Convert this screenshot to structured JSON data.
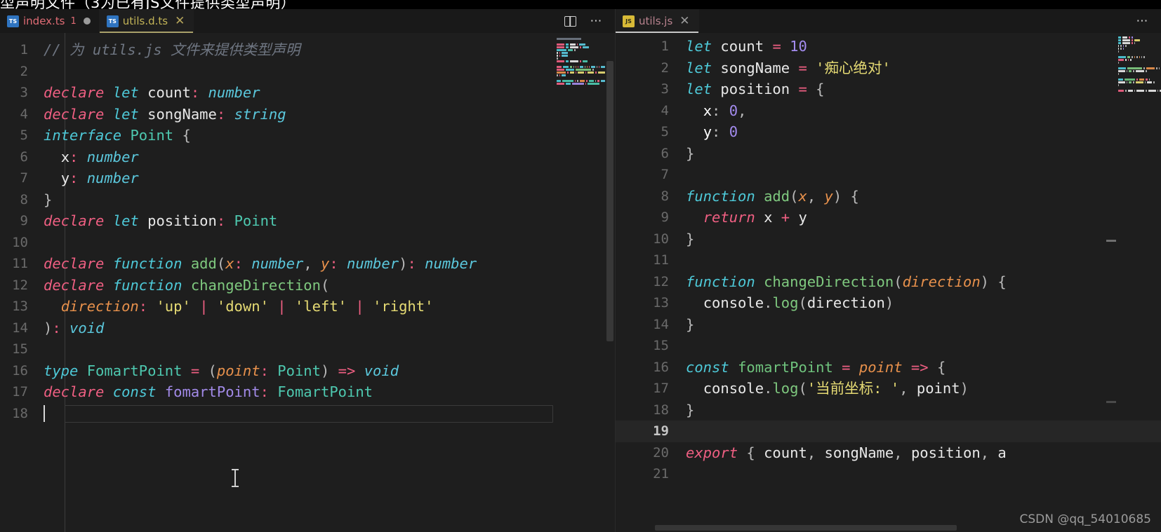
{
  "window": {
    "top_caption": "型声明文件（3为已有JS文件提供类型声明）",
    "watermark": "CSDN @qq_54010685"
  },
  "left_pane": {
    "tabs": [
      {
        "label": "index.ts",
        "icon": "ts-file-icon",
        "error_count": "1",
        "dirty": true,
        "active": false,
        "close": ""
      },
      {
        "label": "utils.d.ts",
        "icon": "ts-file-icon",
        "error_count": "",
        "dirty": false,
        "active": true,
        "close": "✕"
      }
    ],
    "actions": {
      "split": "split-editor-icon",
      "more": "⋯"
    },
    "file_language": "typescript",
    "cursor_line": 18,
    "lines": [
      {
        "n": 1,
        "tokens": [
          {
            "t": "// 为 utils.js 文件来提供类型声明",
            "c": "t-com"
          }
        ]
      },
      {
        "n": 2,
        "tokens": []
      },
      {
        "n": 3,
        "tokens": [
          {
            "t": "declare",
            "c": "t-kw"
          },
          {
            "t": " ",
            "c": "t-ws"
          },
          {
            "t": "let",
            "c": "t-kw2"
          },
          {
            "t": " ",
            "c": "t-ws"
          },
          {
            "t": "count",
            "c": "t-var"
          },
          {
            "t": ":",
            "c": "t-op"
          },
          {
            "t": " ",
            "c": "t-ws"
          },
          {
            "t": "number",
            "c": "t-type"
          }
        ]
      },
      {
        "n": 4,
        "tokens": [
          {
            "t": "declare",
            "c": "t-kw"
          },
          {
            "t": " ",
            "c": "t-ws"
          },
          {
            "t": "let",
            "c": "t-kw2"
          },
          {
            "t": " ",
            "c": "t-ws"
          },
          {
            "t": "songName",
            "c": "t-var"
          },
          {
            "t": ":",
            "c": "t-op"
          },
          {
            "t": " ",
            "c": "t-ws"
          },
          {
            "t": "string",
            "c": "t-type"
          }
        ]
      },
      {
        "n": 5,
        "tokens": [
          {
            "t": "interface",
            "c": "t-kw2"
          },
          {
            "t": " ",
            "c": "t-ws"
          },
          {
            "t": "Point",
            "c": "t-typ2"
          },
          {
            "t": " ",
            "c": "t-ws"
          },
          {
            "t": "{",
            "c": "t-punc"
          }
        ]
      },
      {
        "n": 6,
        "tokens": [
          {
            "t": "  ",
            "c": "t-ws"
          },
          {
            "t": "x",
            "c": "t-var"
          },
          {
            "t": ":",
            "c": "t-op"
          },
          {
            "t": " ",
            "c": "t-ws"
          },
          {
            "t": "number",
            "c": "t-type"
          }
        ]
      },
      {
        "n": 7,
        "tokens": [
          {
            "t": "  ",
            "c": "t-ws"
          },
          {
            "t": "y",
            "c": "t-var"
          },
          {
            "t": ":",
            "c": "t-op"
          },
          {
            "t": " ",
            "c": "t-ws"
          },
          {
            "t": "number",
            "c": "t-type"
          }
        ]
      },
      {
        "n": 8,
        "tokens": [
          {
            "t": "}",
            "c": "t-punc"
          }
        ]
      },
      {
        "n": 9,
        "tokens": [
          {
            "t": "declare",
            "c": "t-kw"
          },
          {
            "t": " ",
            "c": "t-ws"
          },
          {
            "t": "let",
            "c": "t-kw2"
          },
          {
            "t": " ",
            "c": "t-ws"
          },
          {
            "t": "position",
            "c": "t-var"
          },
          {
            "t": ":",
            "c": "t-op"
          },
          {
            "t": " ",
            "c": "t-ws"
          },
          {
            "t": "Point",
            "c": "t-typ2"
          }
        ]
      },
      {
        "n": 10,
        "tokens": []
      },
      {
        "n": 11,
        "tokens": [
          {
            "t": "declare",
            "c": "t-kw"
          },
          {
            "t": " ",
            "c": "t-ws"
          },
          {
            "t": "function",
            "c": "t-kw2"
          },
          {
            "t": " ",
            "c": "t-ws"
          },
          {
            "t": "add",
            "c": "t-fn"
          },
          {
            "t": "(",
            "c": "t-punc"
          },
          {
            "t": "x",
            "c": "t-param"
          },
          {
            "t": ":",
            "c": "t-op"
          },
          {
            "t": " ",
            "c": "t-ws"
          },
          {
            "t": "number",
            "c": "t-type"
          },
          {
            "t": ",",
            "c": "t-punc"
          },
          {
            "t": " ",
            "c": "t-ws"
          },
          {
            "t": "y",
            "c": "t-param"
          },
          {
            "t": ":",
            "c": "t-op"
          },
          {
            "t": " ",
            "c": "t-ws"
          },
          {
            "t": "number",
            "c": "t-type"
          },
          {
            "t": ")",
            "c": "t-punc"
          },
          {
            "t": ":",
            "c": "t-op"
          },
          {
            "t": " ",
            "c": "t-ws"
          },
          {
            "t": "number",
            "c": "t-type"
          }
        ]
      },
      {
        "n": 12,
        "tokens": [
          {
            "t": "declare",
            "c": "t-kw"
          },
          {
            "t": " ",
            "c": "t-ws"
          },
          {
            "t": "function",
            "c": "t-kw2"
          },
          {
            "t": " ",
            "c": "t-ws"
          },
          {
            "t": "changeDirection",
            "c": "t-fn"
          },
          {
            "t": "(",
            "c": "t-punc"
          }
        ]
      },
      {
        "n": 13,
        "tokens": [
          {
            "t": "  ",
            "c": "t-ws"
          },
          {
            "t": "direction",
            "c": "t-param"
          },
          {
            "t": ":",
            "c": "t-op"
          },
          {
            "t": " ",
            "c": "t-ws"
          },
          {
            "t": "'up'",
            "c": "t-str"
          },
          {
            "t": " ",
            "c": "t-ws"
          },
          {
            "t": "|",
            "c": "t-op"
          },
          {
            "t": " ",
            "c": "t-ws"
          },
          {
            "t": "'down'",
            "c": "t-str"
          },
          {
            "t": " ",
            "c": "t-ws"
          },
          {
            "t": "|",
            "c": "t-op"
          },
          {
            "t": " ",
            "c": "t-ws"
          },
          {
            "t": "'left'",
            "c": "t-str"
          },
          {
            "t": " ",
            "c": "t-ws"
          },
          {
            "t": "|",
            "c": "t-op"
          },
          {
            "t": " ",
            "c": "t-ws"
          },
          {
            "t": "'right'",
            "c": "t-str"
          }
        ]
      },
      {
        "n": 14,
        "tokens": [
          {
            "t": ")",
            "c": "t-punc"
          },
          {
            "t": ":",
            "c": "t-op"
          },
          {
            "t": " ",
            "c": "t-ws"
          },
          {
            "t": "void",
            "c": "t-type"
          }
        ]
      },
      {
        "n": 15,
        "tokens": []
      },
      {
        "n": 16,
        "tokens": [
          {
            "t": "type",
            "c": "t-kw2"
          },
          {
            "t": " ",
            "c": "t-ws"
          },
          {
            "t": "FomartPoint",
            "c": "t-typ2"
          },
          {
            "t": " ",
            "c": "t-ws"
          },
          {
            "t": "=",
            "c": "t-op"
          },
          {
            "t": " ",
            "c": "t-ws"
          },
          {
            "t": "(",
            "c": "t-punc"
          },
          {
            "t": "point",
            "c": "t-param"
          },
          {
            "t": ":",
            "c": "t-op"
          },
          {
            "t": " ",
            "c": "t-ws"
          },
          {
            "t": "Point",
            "c": "t-typ2"
          },
          {
            "t": ")",
            "c": "t-punc"
          },
          {
            "t": " ",
            "c": "t-ws"
          },
          {
            "t": "=>",
            "c": "t-op"
          },
          {
            "t": " ",
            "c": "t-ws"
          },
          {
            "t": "void",
            "c": "t-type"
          }
        ]
      },
      {
        "n": 17,
        "tokens": [
          {
            "t": "declare",
            "c": "t-kw"
          },
          {
            "t": " ",
            "c": "t-ws"
          },
          {
            "t": "const",
            "c": "t-kw2"
          },
          {
            "t": " ",
            "c": "t-ws"
          },
          {
            "t": "fomartPoint",
            "c": "t-ident"
          },
          {
            "t": ":",
            "c": "t-op"
          },
          {
            "t": " ",
            "c": "t-ws"
          },
          {
            "t": "FomartPoint",
            "c": "t-typ2"
          }
        ]
      },
      {
        "n": 18,
        "tokens": [],
        "caret": true,
        "selected_line": true
      }
    ]
  },
  "right_pane": {
    "tabs": [
      {
        "label": "utils.js",
        "icon": "js-file-icon",
        "error_count": "",
        "dirty": false,
        "active": true,
        "close": "✕"
      }
    ],
    "actions": {
      "more": "⋯"
    },
    "file_language": "javascript",
    "current_line": 19,
    "lines": [
      {
        "n": 1,
        "tokens": [
          {
            "t": "let",
            "c": "t-kw2"
          },
          {
            "t": " ",
            "c": "t-ws"
          },
          {
            "t": "count",
            "c": "t-var"
          },
          {
            "t": " ",
            "c": "t-ws"
          },
          {
            "t": "=",
            "c": "t-op"
          },
          {
            "t": " ",
            "c": "t-ws"
          },
          {
            "t": "10",
            "c": "t-num"
          }
        ]
      },
      {
        "n": 2,
        "tokens": [
          {
            "t": "let",
            "c": "t-kw2"
          },
          {
            "t": " ",
            "c": "t-ws"
          },
          {
            "t": "songName",
            "c": "t-var"
          },
          {
            "t": " ",
            "c": "t-ws"
          },
          {
            "t": "=",
            "c": "t-op"
          },
          {
            "t": " ",
            "c": "t-ws"
          },
          {
            "t": "'痴心绝对'",
            "c": "t-str"
          }
        ]
      },
      {
        "n": 3,
        "tokens": [
          {
            "t": "let",
            "c": "t-kw2"
          },
          {
            "t": " ",
            "c": "t-ws"
          },
          {
            "t": "position",
            "c": "t-var"
          },
          {
            "t": " ",
            "c": "t-ws"
          },
          {
            "t": "=",
            "c": "t-op"
          },
          {
            "t": " ",
            "c": "t-ws"
          },
          {
            "t": "{",
            "c": "t-punc"
          }
        ]
      },
      {
        "n": 4,
        "tokens": [
          {
            "t": "  ",
            "c": "t-ws"
          },
          {
            "t": "x",
            "c": "t-prop"
          },
          {
            "t": ":",
            "c": "t-punc"
          },
          {
            "t": " ",
            "c": "t-ws"
          },
          {
            "t": "0",
            "c": "t-num"
          },
          {
            "t": ",",
            "c": "t-punc"
          }
        ]
      },
      {
        "n": 5,
        "tokens": [
          {
            "t": "  ",
            "c": "t-ws"
          },
          {
            "t": "y",
            "c": "t-prop"
          },
          {
            "t": ":",
            "c": "t-punc"
          },
          {
            "t": " ",
            "c": "t-ws"
          },
          {
            "t": "0",
            "c": "t-num"
          }
        ]
      },
      {
        "n": 6,
        "tokens": [
          {
            "t": "}",
            "c": "t-punc"
          }
        ]
      },
      {
        "n": 7,
        "tokens": []
      },
      {
        "n": 8,
        "tokens": [
          {
            "t": "function",
            "c": "t-kw2"
          },
          {
            "t": " ",
            "c": "t-ws"
          },
          {
            "t": "add",
            "c": "t-fn"
          },
          {
            "t": "(",
            "c": "t-punc"
          },
          {
            "t": "x",
            "c": "t-param"
          },
          {
            "t": ",",
            "c": "t-punc"
          },
          {
            "t": " ",
            "c": "t-ws"
          },
          {
            "t": "y",
            "c": "t-param"
          },
          {
            "t": ")",
            "c": "t-punc"
          },
          {
            "t": " ",
            "c": "t-ws"
          },
          {
            "t": "{",
            "c": "t-punc"
          }
        ]
      },
      {
        "n": 9,
        "tokens": [
          {
            "t": "  ",
            "c": "t-ws"
          },
          {
            "t": "return",
            "c": "t-kw"
          },
          {
            "t": " ",
            "c": "t-ws"
          },
          {
            "t": "x",
            "c": "t-var"
          },
          {
            "t": " ",
            "c": "t-ws"
          },
          {
            "t": "+",
            "c": "t-op"
          },
          {
            "t": " ",
            "c": "t-ws"
          },
          {
            "t": "y",
            "c": "t-var"
          }
        ]
      },
      {
        "n": 10,
        "tokens": [
          {
            "t": "}",
            "c": "t-punc"
          }
        ]
      },
      {
        "n": 11,
        "tokens": []
      },
      {
        "n": 12,
        "tokens": [
          {
            "t": "function",
            "c": "t-kw2"
          },
          {
            "t": " ",
            "c": "t-ws"
          },
          {
            "t": "changeDirection",
            "c": "t-fn"
          },
          {
            "t": "(",
            "c": "t-punc"
          },
          {
            "t": "direction",
            "c": "t-param"
          },
          {
            "t": ")",
            "c": "t-punc"
          },
          {
            "t": " ",
            "c": "t-ws"
          },
          {
            "t": "{",
            "c": "t-punc"
          }
        ]
      },
      {
        "n": 13,
        "tokens": [
          {
            "t": "  ",
            "c": "t-ws"
          },
          {
            "t": "console",
            "c": "t-var"
          },
          {
            "t": ".",
            "c": "t-punc"
          },
          {
            "t": "log",
            "c": "t-fn"
          },
          {
            "t": "(",
            "c": "t-punc"
          },
          {
            "t": "direction",
            "c": "t-var"
          },
          {
            "t": ")",
            "c": "t-punc"
          }
        ]
      },
      {
        "n": 14,
        "tokens": [
          {
            "t": "}",
            "c": "t-punc"
          }
        ]
      },
      {
        "n": 15,
        "tokens": []
      },
      {
        "n": 16,
        "tokens": [
          {
            "t": "const",
            "c": "t-kw2"
          },
          {
            "t": " ",
            "c": "t-ws"
          },
          {
            "t": "fomartPoint",
            "c": "t-grn"
          },
          {
            "t": " ",
            "c": "t-ws"
          },
          {
            "t": "=",
            "c": "t-op"
          },
          {
            "t": " ",
            "c": "t-ws"
          },
          {
            "t": "point",
            "c": "t-param"
          },
          {
            "t": " ",
            "c": "t-ws"
          },
          {
            "t": "=>",
            "c": "t-op"
          },
          {
            "t": " ",
            "c": "t-ws"
          },
          {
            "t": "{",
            "c": "t-punc"
          }
        ]
      },
      {
        "n": 17,
        "tokens": [
          {
            "t": "  ",
            "c": "t-ws"
          },
          {
            "t": "console",
            "c": "t-var"
          },
          {
            "t": ".",
            "c": "t-punc"
          },
          {
            "t": "log",
            "c": "t-fn"
          },
          {
            "t": "(",
            "c": "t-punc"
          },
          {
            "t": "'当前坐标: '",
            "c": "t-str"
          },
          {
            "t": ",",
            "c": "t-punc"
          },
          {
            "t": " ",
            "c": "t-ws"
          },
          {
            "t": "point",
            "c": "t-var"
          },
          {
            "t": ")",
            "c": "t-punc"
          }
        ]
      },
      {
        "n": 18,
        "tokens": [
          {
            "t": "}",
            "c": "t-punc"
          }
        ]
      },
      {
        "n": 19,
        "tokens": [],
        "current": true
      },
      {
        "n": 20,
        "tokens": [
          {
            "t": "export",
            "c": "t-kw"
          },
          {
            "t": " ",
            "c": "t-ws"
          },
          {
            "t": "{",
            "c": "t-punc"
          },
          {
            "t": " ",
            "c": "t-ws"
          },
          {
            "t": "count",
            "c": "t-var"
          },
          {
            "t": ",",
            "c": "t-punc"
          },
          {
            "t": " ",
            "c": "t-ws"
          },
          {
            "t": "songName",
            "c": "t-var"
          },
          {
            "t": ",",
            "c": "t-punc"
          },
          {
            "t": " ",
            "c": "t-ws"
          },
          {
            "t": "position",
            "c": "t-var"
          },
          {
            "t": ",",
            "c": "t-punc"
          },
          {
            "t": " ",
            "c": "t-ws"
          },
          {
            "t": "a",
            "c": "t-var"
          }
        ]
      },
      {
        "n": 21,
        "tokens": []
      }
    ]
  },
  "theme": {
    "editor_bg": "#1e1e1e",
    "tabbar_bg": "#191919",
    "line_number": "#6a6a6a",
    "active_tab_border": "#a9a06a",
    "comment": "#6f7682",
    "keyword_declare": "#ef5f82",
    "keyword_let": "#4ec9d8",
    "type": "#5bc8dd",
    "type_name": "#4ec9b0",
    "function": "#7fc97f",
    "parameter": "#e8914c",
    "string": "#e6db74",
    "number": "#a48cf0",
    "operator": "#ef5f82"
  }
}
